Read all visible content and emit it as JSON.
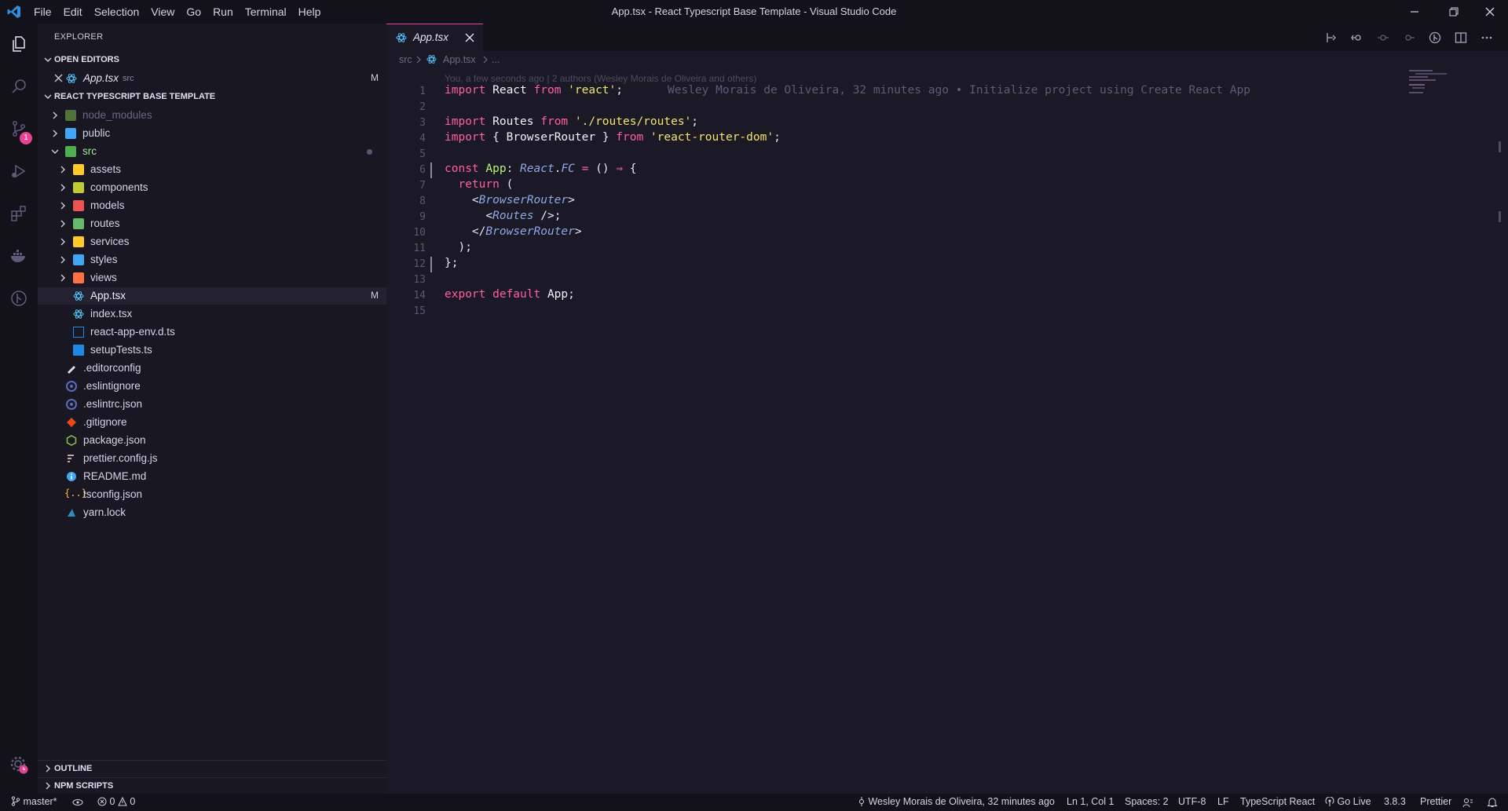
{
  "window": {
    "title": "App.tsx - React Typescript Base Template - Visual Studio Code",
    "menu": [
      "File",
      "Edit",
      "Selection",
      "View",
      "Go",
      "Run",
      "Terminal",
      "Help"
    ]
  },
  "activity_bar": {
    "icons": [
      "files-icon",
      "search-icon",
      "source-control-icon",
      "run-debug-icon",
      "extensions-icon",
      "docker-icon",
      "gitlens-icon",
      "settings-gear-icon"
    ],
    "scm_badge": "1"
  },
  "sidebar": {
    "title": "EXPLORER",
    "open_editors": {
      "header": "OPEN EDITORS",
      "items": [
        {
          "name": "App.tsx",
          "folder": "src",
          "status": "M"
        }
      ]
    },
    "project": {
      "header": "REACT TYPESCRIPT BASE TEMPLATE",
      "items": [
        {
          "name": "node_modules",
          "type": "folder",
          "color": "#7bbf4b"
        },
        {
          "name": "public",
          "type": "folder",
          "color": "#42a5f5"
        },
        {
          "name": "src",
          "type": "folder-open",
          "color": "#4caf50"
        },
        {
          "name": "assets",
          "type": "folder",
          "color": "#ffca28"
        },
        {
          "name": "components",
          "type": "folder",
          "color": "#c0ca33"
        },
        {
          "name": "models",
          "type": "folder",
          "color": "#ef5350"
        },
        {
          "name": "routes",
          "type": "folder",
          "color": "#66bb6a"
        },
        {
          "name": "services",
          "type": "folder",
          "color": "#ffca28"
        },
        {
          "name": "styles",
          "type": "folder",
          "color": "#42a5f5"
        },
        {
          "name": "views",
          "type": "folder",
          "color": "#ff7043"
        },
        {
          "name": "App.tsx",
          "type": "file",
          "status": "M",
          "color": "#4fc3f7"
        },
        {
          "name": "index.tsx",
          "type": "file",
          "color": "#4fc3f7"
        },
        {
          "name": "react-app-env.d.ts",
          "type": "file",
          "color": "#1e88e5"
        },
        {
          "name": "setupTests.ts",
          "type": "file",
          "color": "#1e88e5"
        },
        {
          "name": ".editorconfig",
          "type": "file",
          "color": "#e0e0e0"
        },
        {
          "name": ".eslintignore",
          "type": "file",
          "color": "#5c6bc0"
        },
        {
          "name": ".eslintrc.json",
          "type": "file",
          "color": "#5c6bc0"
        },
        {
          "name": ".gitignore",
          "type": "file",
          "color": "#e64a19"
        },
        {
          "name": "package.json",
          "type": "file",
          "color": "#8bc34a"
        },
        {
          "name": "prettier.config.js",
          "type": "file",
          "color": "#bcaaa4"
        },
        {
          "name": "README.md",
          "type": "file",
          "color": "#42a5f5"
        },
        {
          "name": "tsconfig.json",
          "type": "file",
          "color": "#fbc02d"
        },
        {
          "name": "yarn.lock",
          "type": "file",
          "color": "#2c8ebb"
        }
      ]
    },
    "outline": "OUTLINE",
    "npm_scripts": "NPM SCRIPTS"
  },
  "editor": {
    "tab": {
      "label": "App.tsx"
    },
    "breadcrumb": [
      "src",
      "App.tsx",
      "..."
    ],
    "codelens": "You, a few seconds ago | 2 authors (Wesley Morais de Oliveira and others)",
    "blame": "Wesley Morais de Oliveira, 32 minutes ago • Initialize project using Create React App",
    "lines": [
      "import React from 'react';",
      "",
      "import Routes from './routes/routes';",
      "import { BrowserRouter } from 'react-router-dom';",
      "",
      "const App: React.FC = () ⇒ {",
      "  return (",
      "    <BrowserRouter>",
      "      <Routes />;",
      "    </BrowserRouter>",
      "  );",
      "};",
      "",
      "export default App;",
      ""
    ]
  },
  "statusbar": {
    "branch": "master*",
    "errors": "0",
    "warnings": "0",
    "blame": "Wesley Morais de Oliveira, 32 minutes ago",
    "cursor": "Ln 1, Col 1",
    "spaces": "Spaces: 2",
    "encoding": "UTF-8",
    "eol": "LF",
    "language": "TypeScript React",
    "golive": "Go Live",
    "ts_version": "3.8.3",
    "formatter": "Prettier"
  }
}
